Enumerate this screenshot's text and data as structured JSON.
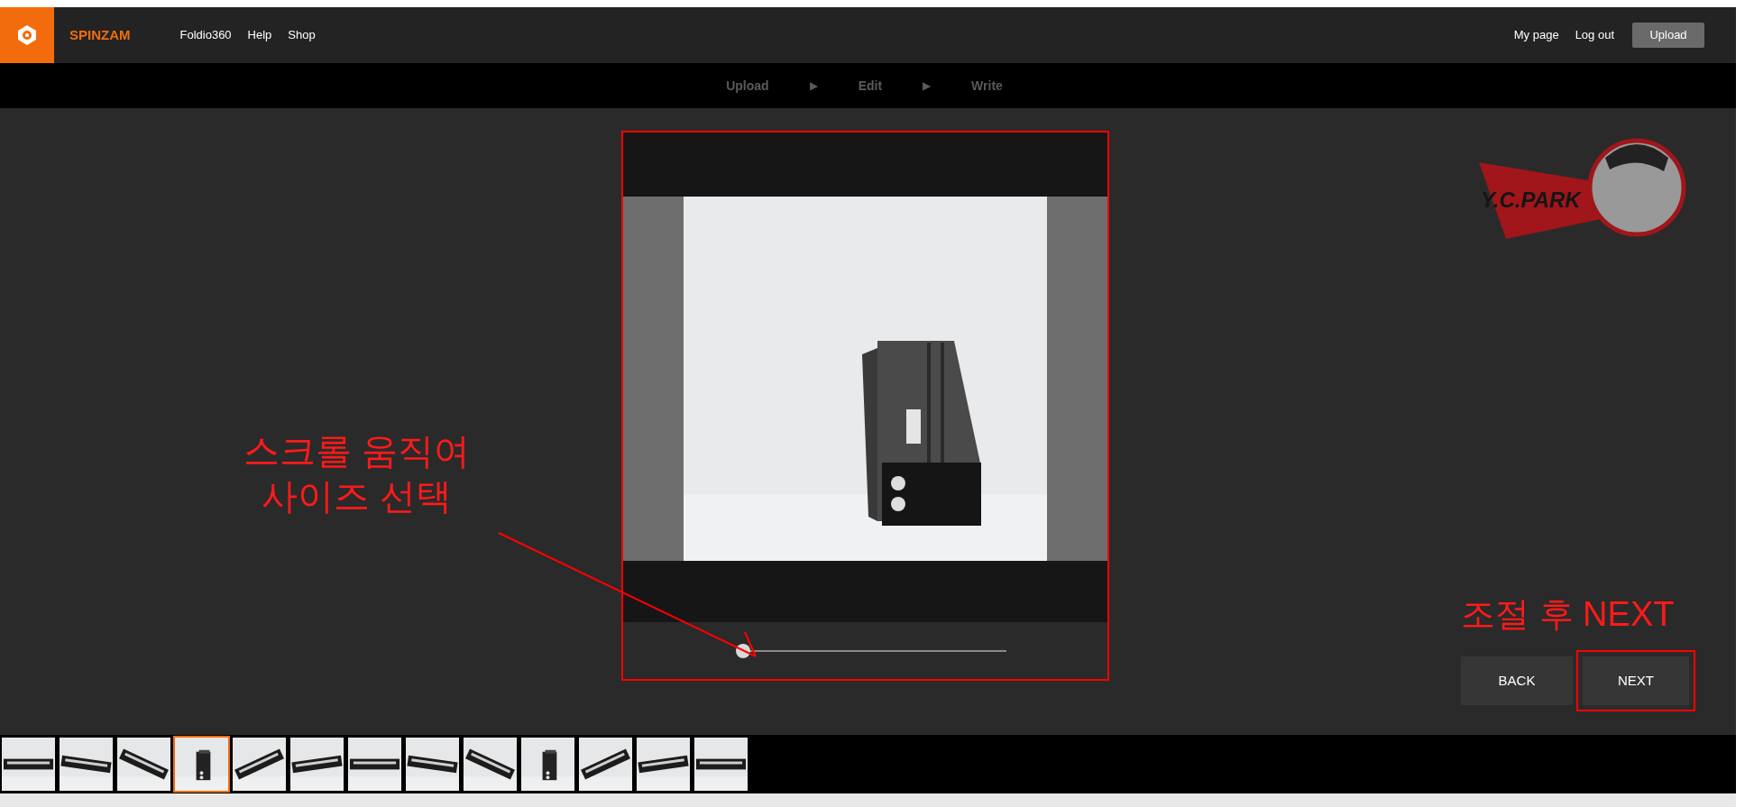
{
  "header": {
    "brand": "SPINZAM",
    "nav": [
      "Foldio360",
      "Help",
      "Shop"
    ],
    "user_links": [
      "My page",
      "Log out"
    ],
    "upload_button": "Upload"
  },
  "steps": [
    {
      "label": "Upload"
    },
    {
      "label": "Edit"
    },
    {
      "label": "Write"
    }
  ],
  "step_arrows": [
    "▶",
    "▶"
  ],
  "editor": {
    "zoom_slider": {
      "level": 0
    }
  },
  "logo": {
    "text": "Y.C.PARK"
  },
  "annotations": {
    "slider_note": [
      "스크롤 움직여",
      "사이즈 선택"
    ],
    "next_note": "조절 후 NEXT"
  },
  "buttons": [
    "BACK",
    "NEXT"
  ],
  "thumbnails": [
    {
      "selected": false
    },
    {
      "selected": false
    },
    {
      "selected": false
    },
    {
      "selected": true
    },
    {
      "selected": false
    },
    {
      "selected": false
    },
    {
      "selected": false
    },
    {
      "selected": false
    },
    {
      "selected": false
    },
    {
      "selected": false
    },
    {
      "selected": false
    },
    {
      "selected": false
    },
    {
      "selected": false
    }
  ]
}
